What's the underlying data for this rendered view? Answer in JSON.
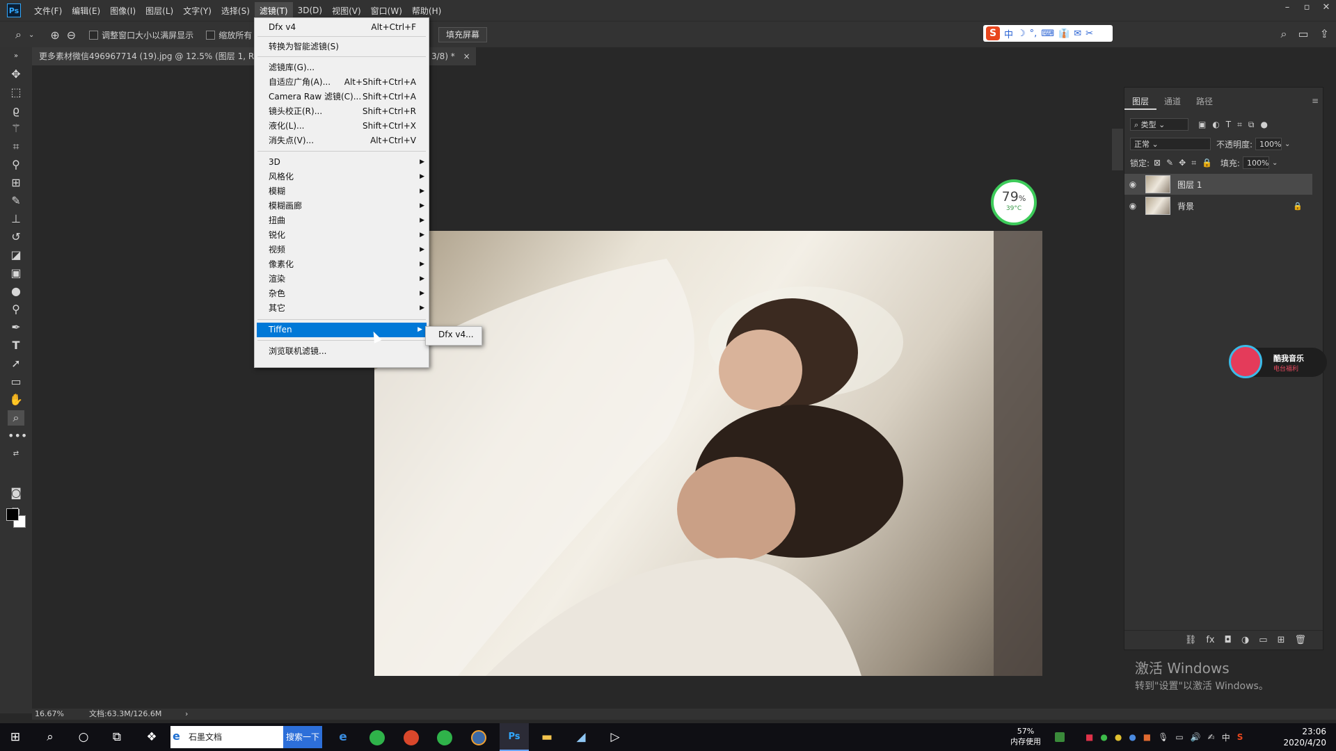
{
  "app": {
    "logo": "Ps",
    "menus": [
      "文件(F)",
      "编辑(E)",
      "图像(I)",
      "图层(L)",
      "文字(Y)",
      "选择(S)",
      "滤镜(T)",
      "3D(D)",
      "视图(V)",
      "窗口(W)",
      "帮助(H)"
    ],
    "active_menu": "滤镜(T)"
  },
  "options": {
    "resize_window_label": "调整窗口大小以满屏显示",
    "zoom_all_label": "缩放所有",
    "fill_screen": "填充屏幕"
  },
  "ime_bar": {
    "items": [
      "中",
      "☽",
      "°,",
      "⌨",
      "👔",
      "✉",
      "✂"
    ]
  },
  "document": {
    "tab_title": "更多素材微信496967714 (19).jpg @ 12.5% (图层 1, RGB/",
    "tab_tail": "3/8) *",
    "close": "×"
  },
  "gauge": {
    "percent": "79",
    "unit": "%",
    "temp": "39°C"
  },
  "filter_menu": {
    "items": [
      {
        "label": "Dfx v4",
        "shortcut": "Alt+Ctrl+F"
      },
      {
        "label": "转换为智能滤镜(S)",
        "shortcut": ""
      },
      {
        "label": "滤镜库(G)...",
        "shortcut": ""
      },
      {
        "label": "自适应广角(A)...",
        "shortcut": "Alt+Shift+Ctrl+A"
      },
      {
        "label": "Camera Raw 滤镜(C)...",
        "shortcut": "Shift+Ctrl+A"
      },
      {
        "label": "镜头校正(R)...",
        "shortcut": "Shift+Ctrl+R"
      },
      {
        "label": "液化(L)...",
        "shortcut": "Shift+Ctrl+X"
      },
      {
        "label": "消失点(V)...",
        "shortcut": "Alt+Ctrl+V"
      },
      {
        "label": "3D",
        "shortcut": ""
      },
      {
        "label": "风格化",
        "shortcut": ""
      },
      {
        "label": "模糊",
        "shortcut": ""
      },
      {
        "label": "模糊画廊",
        "shortcut": ""
      },
      {
        "label": "扭曲",
        "shortcut": ""
      },
      {
        "label": "锐化",
        "shortcut": ""
      },
      {
        "label": "视频",
        "shortcut": ""
      },
      {
        "label": "像素化",
        "shortcut": ""
      },
      {
        "label": "渲染",
        "shortcut": ""
      },
      {
        "label": "杂色",
        "shortcut": ""
      },
      {
        "label": "其它",
        "shortcut": ""
      },
      {
        "label": "Tiffen",
        "shortcut": ""
      },
      {
        "label": "浏览联机滤镜...",
        "shortcut": ""
      }
    ],
    "highlighted": "Tiffen",
    "submenu": [
      "Dfx v4..."
    ]
  },
  "layers_panel": {
    "tabs": [
      "图层",
      "通道",
      "路径"
    ],
    "filter_kind": "类型",
    "blend_mode": "正常",
    "opacity_label": "不透明度:",
    "opacity": "100%",
    "lock_label": "锁定:",
    "fill_label": "填充:",
    "fill": "100%",
    "layers": [
      {
        "name": "图层 1",
        "selected": true,
        "locked": false
      },
      {
        "name": "背景",
        "selected": false,
        "locked": true
      }
    ],
    "bottom_icons": [
      "⛓",
      "fx",
      "◘",
      "◑",
      "▭",
      "⊞",
      "🗑"
    ]
  },
  "activate_windows": {
    "title": "激活 Windows",
    "subtitle": "转到\"设置\"以激活 Windows。"
  },
  "music_widget": {
    "title": "酷我音乐",
    "subtitle": "电台福利"
  },
  "status": {
    "zoom": "16.67%",
    "doc": "文档:63.3M/126.6M",
    "arrow": "›"
  },
  "taskbar": {
    "search_value": "石墨文档",
    "search_button": "搜索一下",
    "memory_percent": "57%",
    "memory_label": "内存使用",
    "time": "23:06",
    "date": "2020/4/20",
    "ime": "中"
  },
  "colors": {
    "accent": "#0078d7",
    "menu_bg": "#f0f0f0",
    "gauge": "#3dcb5a"
  }
}
